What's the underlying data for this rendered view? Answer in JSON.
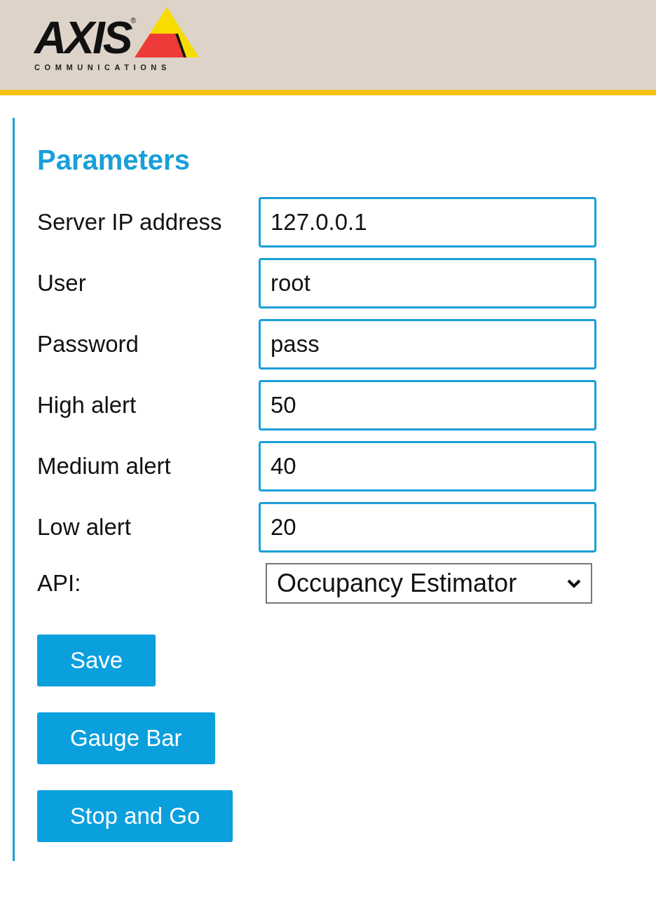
{
  "logo": {
    "wordmark": "AXIS",
    "registered": "®",
    "tagline": "COMMUNICATIONS"
  },
  "heading": "Parameters",
  "fields": [
    {
      "label": "Server IP address",
      "value": "127.0.0.1"
    },
    {
      "label": "User",
      "value": "root"
    },
    {
      "label": "Password",
      "value": "pass"
    },
    {
      "label": "High alert",
      "value": "50"
    },
    {
      "label": "Medium alert",
      "value": "40"
    },
    {
      "label": "Low alert",
      "value": "20"
    }
  ],
  "api": {
    "label": "API:",
    "value": "Occupancy Estimator"
  },
  "buttons": [
    "Save",
    "Gauge Bar",
    "Stop and Go"
  ]
}
